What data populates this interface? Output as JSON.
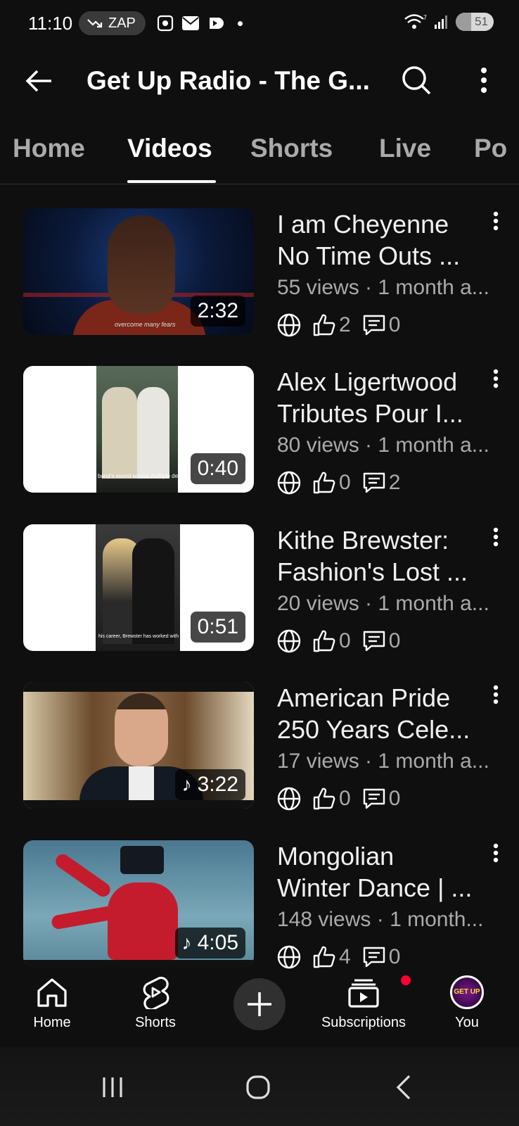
{
  "status_bar": {
    "time": "11:10",
    "zap_label": "ZAP",
    "battery": "51"
  },
  "header": {
    "title": "Get Up Radio - The G..."
  },
  "tabs": [
    {
      "label": "Home"
    },
    {
      "label": "Videos"
    },
    {
      "label": "Shorts"
    },
    {
      "label": "Live"
    },
    {
      "label": "Po"
    }
  ],
  "active_tab": "Videos",
  "videos": [
    {
      "title_line1": "I am Cheyenne",
      "title_line2": "No Time Outs ...",
      "meta": "55 views · 1 month a...",
      "duration": "2:32",
      "music": false,
      "likes": "2",
      "comments": "0",
      "thumb_caption": "overcome many fears"
    },
    {
      "title_line1": "Alex Ligertwood",
      "title_line2": "Tributes Pour I...",
      "meta": "80 views · 1 month a...",
      "duration": "0:40",
      "music": false,
      "likes": "0",
      "comments": "2",
      "thumb_caption": "band's sound across multiple decades."
    },
    {
      "title_line1": "Kithe Brewster:",
      "title_line2": "Fashion's Lost ...",
      "meta": "20 views · 1 month a...",
      "duration": "0:51",
      "music": false,
      "likes": "0",
      "comments": "0",
      "thumb_caption": "his career, Brewster has worked with"
    },
    {
      "title_line1": "American Pride",
      "title_line2": "250 Years Cele...",
      "meta": "17 views · 1 month a...",
      "duration": "3:22",
      "music": true,
      "likes": "0",
      "comments": "0"
    },
    {
      "title_line1": "Mongolian",
      "title_line2": "Winter Dance | ...",
      "meta": "148 views · 1 month...",
      "duration": "4:05",
      "music": true,
      "likes": "4",
      "comments": "0"
    }
  ],
  "bottom_nav": {
    "home": "Home",
    "shorts": "Shorts",
    "subscriptions": "Subscriptions",
    "you": "You",
    "avatar_text": "GET UP"
  },
  "icons": {
    "back": "arrow-left-icon",
    "search": "search-icon",
    "more": "more-vert-icon",
    "visibility": "globe-icon",
    "like": "thumbs-up-icon",
    "comment": "comment-icon",
    "music": "music-note-icon",
    "create": "plus-icon"
  },
  "colors": {
    "background": "#0f0f0f",
    "text_primary": "#f1f1f1",
    "text_secondary": "#aaaaaa",
    "notification": "#ff0033"
  }
}
